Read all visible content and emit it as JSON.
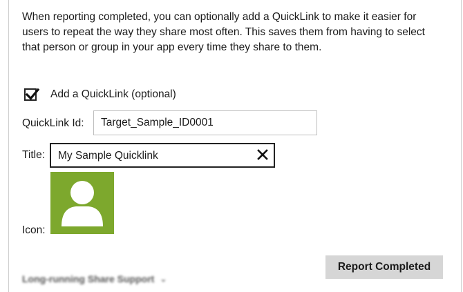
{
  "description": "When reporting completed, you can optionally add a QuickLink to make it easier for users to repeat the way they share most often. This saves them from having to select that person or group in your app every time they share to them.",
  "quicklink_checkbox": {
    "label": "Add a QuickLink (optional)",
    "checked": true
  },
  "quicklink_id": {
    "label": "QuickLink Id:",
    "value": "Target_Sample_ID0001"
  },
  "title_field": {
    "label": "Title:",
    "value": "My Sample Quicklink"
  },
  "icon": {
    "label": "Icon:",
    "semantic": "person-icon",
    "background": "#7da82d"
  },
  "report_button": {
    "label": "Report Completed"
  },
  "long_running": {
    "label": "Long-running Share Support",
    "icon": "chevron-down-icon"
  }
}
